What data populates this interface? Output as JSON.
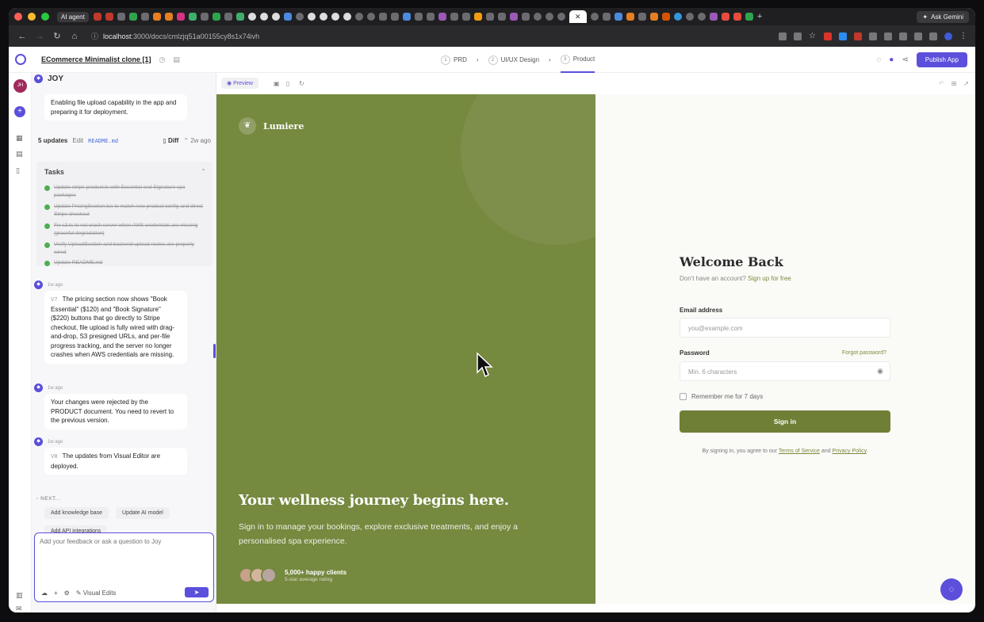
{
  "browser": {
    "ai_agent_tab": "AI agent",
    "gemini": "Ask Gemini",
    "url_host": "localhost",
    "url_path": ":3000/docs/cmlzjq51a00155cy8s1x74ivh"
  },
  "header": {
    "project_title": "ECommerce Minimalist clone [1]",
    "steps": [
      {
        "num": "1",
        "label": "PRD"
      },
      {
        "num": "2",
        "label": "UI/UX Design"
      },
      {
        "num": "3",
        "label": "Product"
      }
    ],
    "publish": "Publish App"
  },
  "rail": {
    "avatar": "JH"
  },
  "chat": {
    "agent_name": "JOY",
    "first_message": "Enabling file upload capability in the app and preparing it for deployment.",
    "updates": {
      "count": "5 updates",
      "edit": "Edit",
      "file": "README.md",
      "diff": "Diff",
      "time": "2w ago"
    },
    "tasks_title": "Tasks",
    "tasks": [
      "Update stripe-product.ts with Essential and Signature spa packages",
      "Update PricingSection.tsx to match new product config and direct Stripe checkout",
      "Fix s3.ts to not crash server when AWS credentials are missing (graceful degradation)",
      "Verify UploadSection and backend upload routes are properly wired",
      "Update README.md"
    ],
    "messages": [
      {
        "time": "1w ago",
        "version": "V7",
        "text": "The pricing section now shows \"Book Essential\" ($120) and \"Book Signature\" ($220) buttons that go directly to Stripe checkout, file upload is fully wired with drag-and-drop, S3 presigned URLs, and per-file progress tracking, and the server no longer crashes when AWS credentials are missing."
      },
      {
        "time": "1w ago",
        "version": "",
        "text": "Your changes were rejected by the PRODUCT document. You need to revert to the previous version."
      },
      {
        "time": "1w ago",
        "version": "V8",
        "text": "The updates from Visual Editor are deployed."
      }
    ],
    "next_label": "NEXT...",
    "chips": [
      "Add knowledge base",
      "Update AI model",
      "Add API integrations"
    ],
    "input_placeholder": "Add your feedback or ask a question to Joy",
    "visual_edits": "Visual Edits"
  },
  "preview": {
    "tab": "Preview",
    "hero": {
      "brand": "Lumiere",
      "headline": "Your wellness journey begins here.",
      "sub": "Sign in to manage your bookings, explore exclusive treatments, and enjoy a personalised spa experience.",
      "clients_main": "5,000+ happy clients",
      "clients_sub": "5-star average rating"
    },
    "login": {
      "title": "Welcome Back",
      "no_account": "Don't have an account?",
      "signup": "Sign up for free",
      "email_label": "Email address",
      "email_placeholder": "you@example.com",
      "password_label": "Password",
      "forgot": "Forgot password?",
      "password_placeholder": "Min. 6 characters",
      "remember": "Remember me for 7 days",
      "signin": "Sign in",
      "terms_prefix": "By signing in, you agree to our",
      "terms": "Terms of Service",
      "and": "and",
      "privacy": "Privacy Policy",
      "terms_suffix": "."
    }
  },
  "colors": {
    "accent": "#5b4fdb",
    "hero_green": "#75893f",
    "button_green": "#6f7f36",
    "link_green": "#7c8b3f"
  }
}
